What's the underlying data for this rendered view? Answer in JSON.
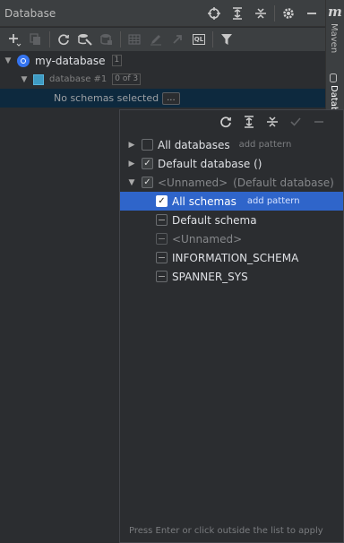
{
  "window": {
    "title": "Database"
  },
  "title_icons": [
    "crosshair-icon",
    "expand-all-icon",
    "collapse-all-icon",
    "settings-icon",
    "minimize-icon"
  ],
  "toolbar": {
    "items": [
      "add-icon",
      "copy-icon",
      "refresh-icon",
      "schema-config-icon",
      "stop-icon",
      "table-view-icon",
      "edit-icon",
      "jump-icon",
      "query-console-icon",
      "filter-icon"
    ],
    "ql_label": "QL"
  },
  "right_strip": {
    "logo": "m",
    "maven_label": "Maven",
    "database_label": "Database"
  },
  "tree": {
    "datasource": {
      "name": "my-database",
      "count": "1"
    },
    "namespace": {
      "name": "database #1",
      "count": "0 of 3"
    },
    "status": {
      "text": "No schemas selected",
      "button": "..."
    }
  },
  "popup": {
    "toolbar_icons": [
      "refresh-icon",
      "expand-all-icon",
      "collapse-all-icon",
      "check-icon",
      "minus-icon"
    ],
    "rows": {
      "all_databases": {
        "label": "All databases",
        "pattern": "add pattern"
      },
      "default_database": {
        "label": "Default database ()"
      },
      "unnamed_db": {
        "label": "<Unnamed>",
        "suffix": "(Default database)"
      },
      "all_schemas": {
        "label": "All schemas",
        "pattern": "add pattern"
      },
      "default_schema": {
        "label": "Default schema"
      },
      "unnamed_schema": {
        "label": "<Unnamed>"
      },
      "information_schema": {
        "label": "INFORMATION_SCHEMA"
      },
      "spanner_sys": {
        "label": "SPANNER_SYS"
      }
    },
    "footer": "Press Enter or click outside the list to apply"
  },
  "colors": {
    "selection": "#2f65ca",
    "accent": "#3574f0",
    "background": "#2b2d30"
  }
}
